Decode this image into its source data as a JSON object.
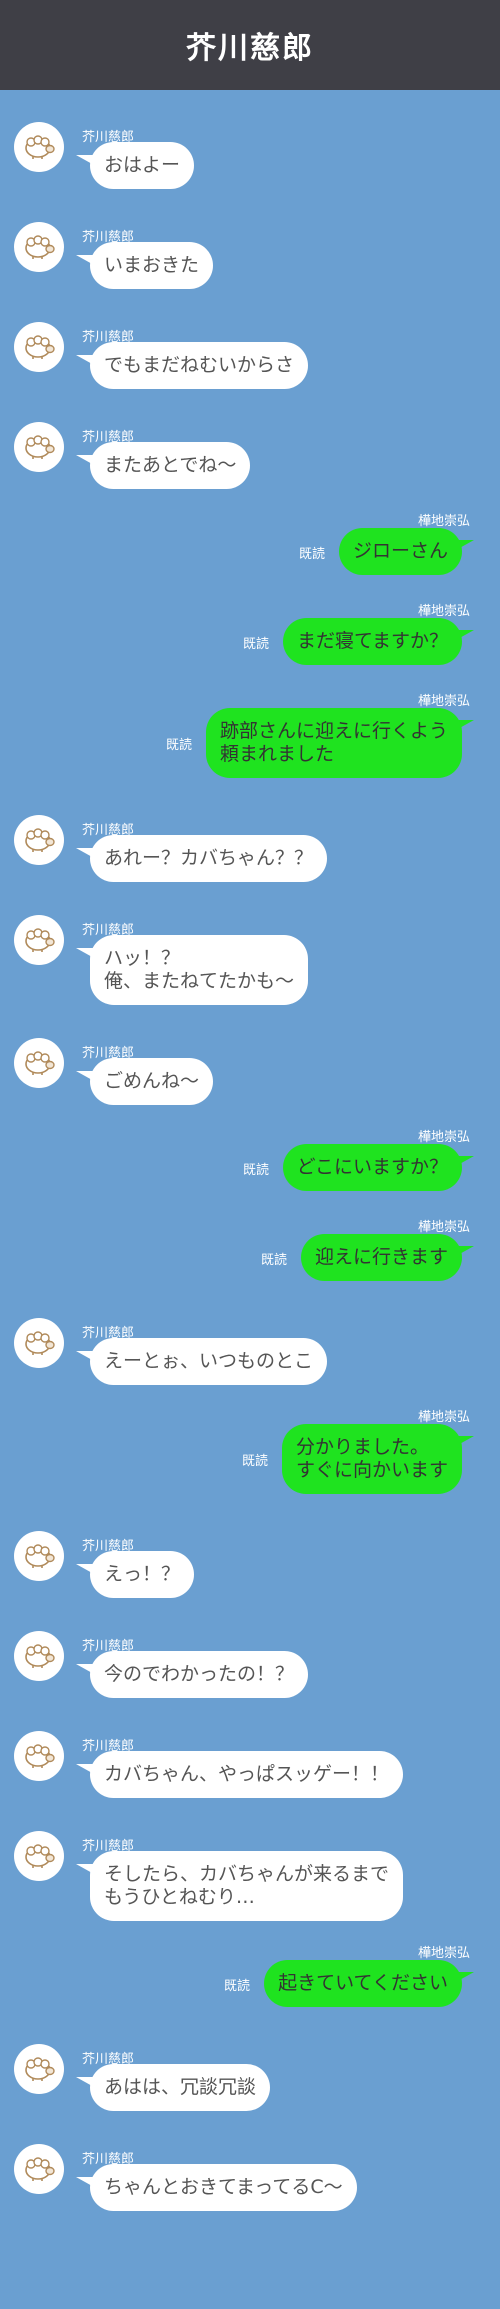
{
  "header": {
    "title": "芥川慈郎"
  },
  "messages": [
    {
      "side": "left",
      "name": "芥川慈郎",
      "lines": [
        "おはよー"
      ]
    },
    {
      "side": "left",
      "name": "芥川慈郎",
      "lines": [
        "いまおきた"
      ]
    },
    {
      "side": "left",
      "name": "芥川慈郎",
      "lines": [
        "でもまだねむいからさ"
      ]
    },
    {
      "side": "left",
      "name": "芥川慈郎",
      "lines": [
        "またあとでね～"
      ]
    },
    {
      "side": "right",
      "name": "樺地崇弘",
      "read": "既読",
      "lines": [
        "ジローさん"
      ]
    },
    {
      "side": "right",
      "name": "樺地崇弘",
      "read": "既読",
      "lines": [
        "まだ寝てますか？"
      ]
    },
    {
      "side": "right",
      "name": "樺地崇弘",
      "read": "既読",
      "lines": [
        "跡部さんに迎えに行くよう",
        "頼まれました"
      ]
    },
    {
      "side": "left",
      "name": "芥川慈郎",
      "lines": [
        "あれー？カバちゃん？？"
      ]
    },
    {
      "side": "left",
      "name": "芥川慈郎",
      "lines": [
        "ハッ！？",
        "俺、またねてたかも～"
      ]
    },
    {
      "side": "left",
      "name": "芥川慈郎",
      "lines": [
        "ごめんね～"
      ]
    },
    {
      "side": "right",
      "name": "樺地崇弘",
      "read": "既読",
      "lines": [
        "どこにいますか？"
      ]
    },
    {
      "side": "right",
      "name": "樺地崇弘",
      "read": "既読",
      "lines": [
        "迎えに行きます"
      ]
    },
    {
      "side": "left",
      "name": "芥川慈郎",
      "lines": [
        "えーとぉ、いつものとこ"
      ]
    },
    {
      "side": "right",
      "name": "樺地崇弘",
      "read": "既読",
      "lines": [
        "分かりました。",
        "すぐに向かいます"
      ]
    },
    {
      "side": "left",
      "name": "芥川慈郎",
      "lines": [
        "えっ！？"
      ]
    },
    {
      "side": "left",
      "name": "芥川慈郎",
      "lines": [
        "今のでわかったの！？"
      ]
    },
    {
      "side": "left",
      "name": "芥川慈郎",
      "lines": [
        "カバちゃん、やっぱスッゲー！！"
      ]
    },
    {
      "side": "left",
      "name": "芥川慈郎",
      "lines": [
        "そしたら、カバちゃんが来るまで",
        "もうひとねむり…"
      ]
    },
    {
      "side": "right",
      "name": "樺地崇弘",
      "read": "既読",
      "lines": [
        "起きていてください"
      ]
    },
    {
      "side": "left",
      "name": "芥川慈郎",
      "lines": [
        "あはは、冗談冗談"
      ]
    },
    {
      "side": "left",
      "name": "芥川慈郎",
      "lines": [
        "ちゃんとおきてまってるC～"
      ]
    }
  ],
  "colors": {
    "background": "#6a9fd1",
    "header": "#3f3f46",
    "left_bubble": "#ffffff",
    "right_bubble": "#1fe31f"
  },
  "icons": {
    "avatar": "sheep-icon"
  }
}
